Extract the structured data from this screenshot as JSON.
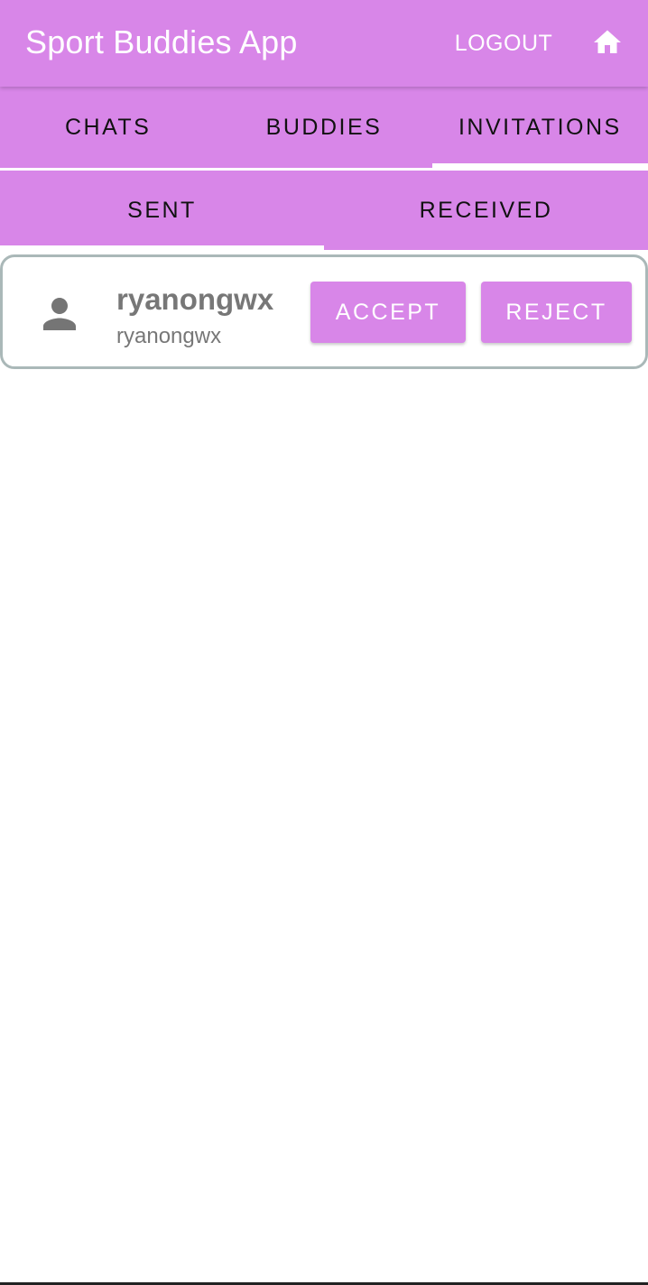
{
  "appbar": {
    "title": "Sport Buddies App",
    "logout_label": "LOGOUT",
    "home_icon": "home-icon"
  },
  "tabs": [
    {
      "label": "CHATS",
      "active": false
    },
    {
      "label": "BUDDIES",
      "active": false
    },
    {
      "label": "INVITATIONS",
      "active": true
    }
  ],
  "subtabs": [
    {
      "label": "SENT",
      "active": true
    },
    {
      "label": "RECEIVED",
      "active": false
    }
  ],
  "invitations": [
    {
      "name": "ryanongwx",
      "handle": "ryanongwx",
      "avatar_icon": "person-icon",
      "accept_label": "ACCEPT",
      "reject_label": "REJECT"
    }
  ],
  "colors": {
    "accent": "#d886e8",
    "on_accent": "#ffffff",
    "tab_text": "#111111",
    "muted_text": "#777777",
    "card_border": "#aab8b8"
  }
}
